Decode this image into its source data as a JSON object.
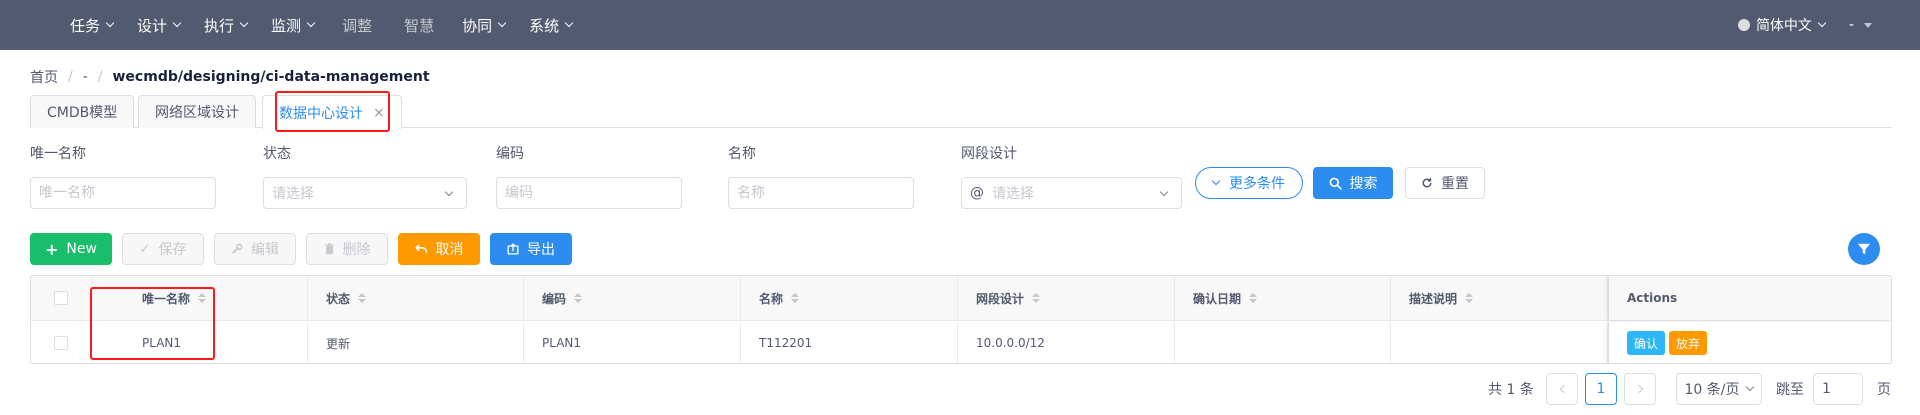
{
  "nav": {
    "items": [
      {
        "label": "任务",
        "dropdown": true
      },
      {
        "label": "设计",
        "dropdown": true
      },
      {
        "label": "执行",
        "dropdown": true
      },
      {
        "label": "监测",
        "dropdown": true
      },
      {
        "label": "调整",
        "dropdown": false
      },
      {
        "label": "智慧",
        "dropdown": false
      },
      {
        "label": "协同",
        "dropdown": true
      },
      {
        "label": "系统",
        "dropdown": true
      }
    ],
    "language": "简体中文",
    "user": "-"
  },
  "breadcrumb": {
    "home": "首页",
    "sep1": "/",
    "mid": "-",
    "sep2": "/",
    "current": "wecmdb/designing/ci-data-management"
  },
  "tabs": [
    {
      "label": "CMDB模型",
      "active": false
    },
    {
      "label": "网络区域设计",
      "active": false
    },
    {
      "label": "数据中心设计",
      "active": true,
      "close": "×"
    }
  ],
  "filters": {
    "unique_name": {
      "label": "唯一名称",
      "placeholder": "唯一名称"
    },
    "status": {
      "label": "状态",
      "placeholder": "请选择"
    },
    "code": {
      "label": "编码",
      "placeholder": "编码"
    },
    "name": {
      "label": "名称",
      "placeholder": "名称"
    },
    "segment": {
      "label": "网段设计",
      "prefix": "@",
      "placeholder": "请选择"
    },
    "more_label": "更多条件",
    "search_label": "搜索",
    "reset_label": "重置"
  },
  "toolbar": {
    "new_label": "New",
    "save_label": "保存",
    "edit_label": "编辑",
    "delete_label": "删除",
    "cancel_label": "取消",
    "export_label": "导出"
  },
  "table": {
    "columns": [
      "唯一名称",
      "状态",
      "编码",
      "名称",
      "网段设计",
      "确认日期",
      "描述说明"
    ],
    "actions_header": "Actions",
    "rows": [
      {
        "cells": [
          "PLAN1",
          "更新",
          "PLAN1",
          "T112201",
          "10.0.0.0/12",
          "",
          ""
        ],
        "actions": [
          "确认",
          "放弃"
        ]
      }
    ]
  },
  "pagination": {
    "total_text": "共 1 条",
    "current_page": "1",
    "page_size": "10 条/页",
    "jump_label": "跳至",
    "jump_value": "1",
    "page_suffix": "页"
  },
  "colors": {
    "nav_bg": "#515a6e",
    "primary": "#2d8cf0",
    "success": "#19be6b",
    "warning": "#ff9900",
    "info": "#2db7f5",
    "annotation": "#ff1a1a"
  }
}
